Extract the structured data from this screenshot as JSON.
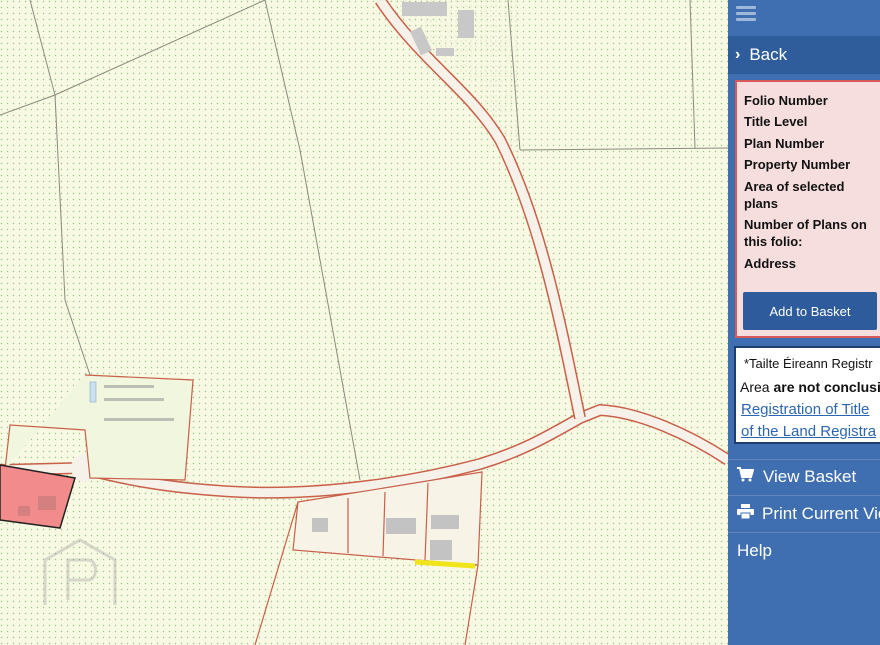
{
  "panel": {
    "back_label": "Back",
    "fields": [
      "Folio Number",
      "Title Level",
      "Plan Number",
      "Property Number",
      "Area of selected plans",
      "Number of Plans on this folio:",
      "Address"
    ],
    "add_to_basket": "Add to Basket",
    "notice": {
      "line1": "*Tailte Éireann Registr",
      "line2_prefix": "Area ",
      "line2_bold": "are not conclusi",
      "link1": "Registration of Title",
      "link2": "of the Land Registra"
    },
    "menu": {
      "view_basket": "View Basket",
      "print_view": "Print Current Vie",
      "help": "Help"
    }
  },
  "colors": {
    "panel_bg": "#3f6fb0",
    "highlight_fill": "#f28b8b",
    "info_border": "#d65a5a",
    "map_bg": "#fafbe6",
    "boundary": "#c9604a"
  }
}
